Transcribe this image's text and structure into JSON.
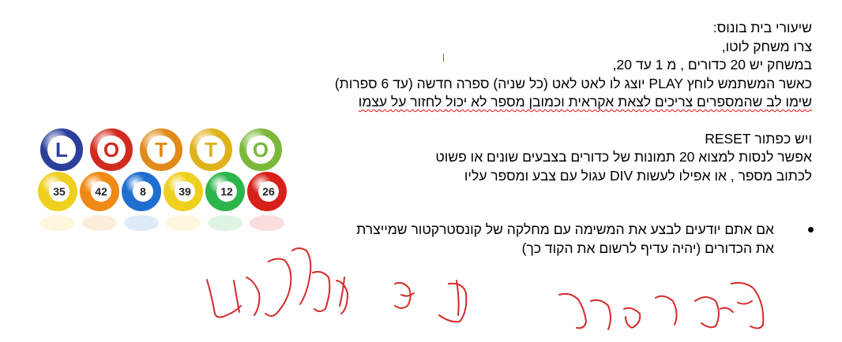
{
  "document": {
    "lines": [
      "שיעורי בית בונוס:",
      "צרו משחק לוטו,",
      "במשחק יש 20 כדורים , מ 1 עד 20,",
      "כאשר המשתמש לוחץ PLAY יוצג לו לאט לאט (כל שניה) ספרה חדשה (עד 6 ספרות)",
      "שימו לב שהמספרים צריכים לצאת אקראית וכמובן מספר לא יכול לחזור על עצמו",
      "ויש כפתור RESET",
      "אפשר לנסות למצוא 20 תמונות של כדורים בצבעים שונים או פשוט",
      "לכתוב מספר , או אפילו לעשות DIV עגול עם צבע ומספר עליו"
    ],
    "bullet": [
      "אם אתם יודעים לבצע את המשימה עם מחלקה של קונסטרקטור שמייצרת",
      "את הכדורים (יהיה עדיף לרשום את הקוד כך)"
    ]
  },
  "logo": {
    "letters": [
      "L",
      "O",
      "T",
      "T",
      "O"
    ],
    "letter_colors": [
      "#2b3f9a",
      "#d22a1f",
      "#e08a1a",
      "#e0b21a",
      "#7cb83a"
    ],
    "balls": [
      {
        "number": "35",
        "color": "#f0d01e"
      },
      {
        "number": "42",
        "color": "#ef8a16"
      },
      {
        "number": "8",
        "color": "#1f6fd0"
      },
      {
        "number": "39",
        "color": "#f0d01e"
      },
      {
        "number": "12",
        "color": "#2cb54a"
      },
      {
        "number": "26",
        "color": "#d8201a"
      }
    ]
  },
  "handwriting": {
    "color": "#d42a2a"
  }
}
